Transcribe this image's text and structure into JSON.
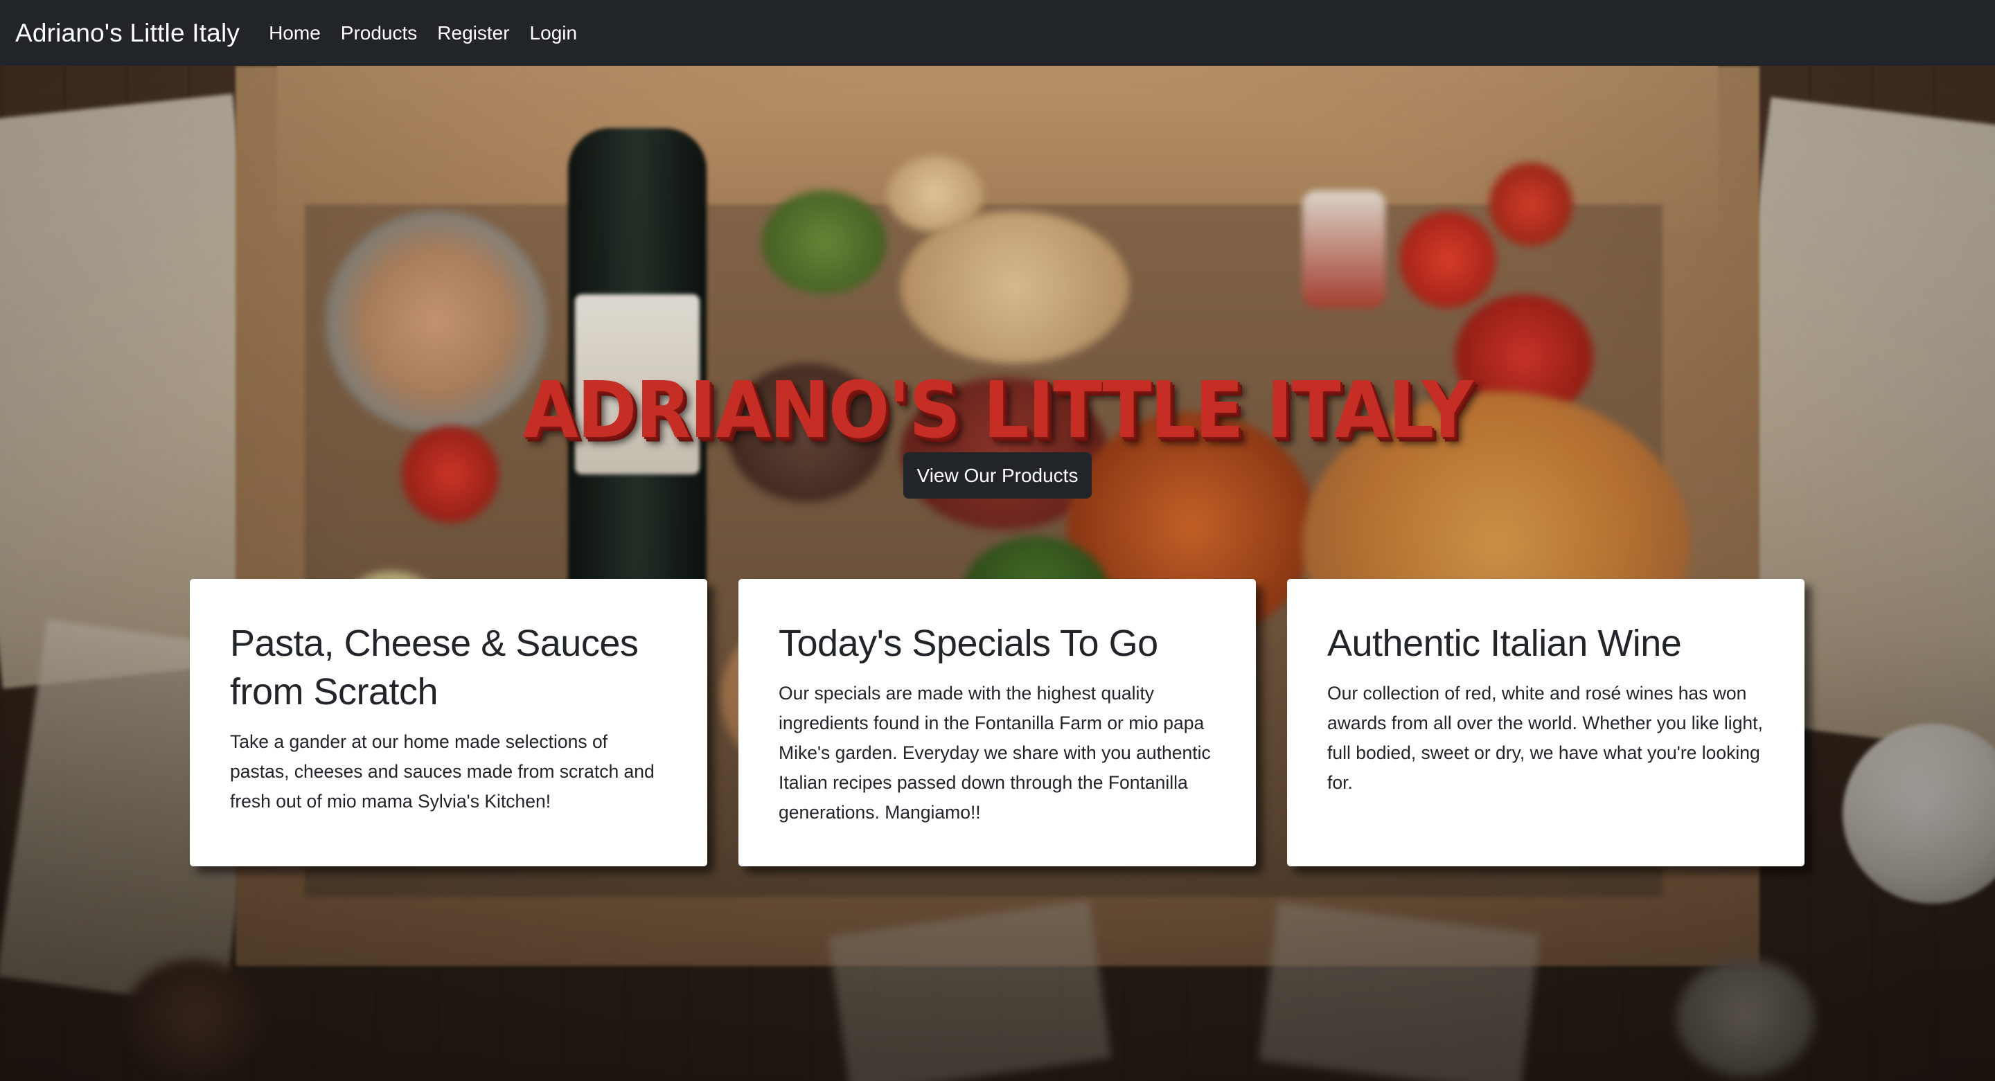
{
  "navbar": {
    "brand": "Adriano's Little Italy",
    "links": [
      {
        "label": "Home"
      },
      {
        "label": "Products"
      },
      {
        "label": "Register"
      },
      {
        "label": "Login"
      }
    ],
    "background": "#212529"
  },
  "hero": {
    "title": "Adriano's Little Italy",
    "title_color": "#c52d25",
    "cta_label": "View Our Products"
  },
  "cards": [
    {
      "title": "Pasta, Cheese & Sauces from Scratch",
      "text": "Take a gander at our home made selections of pastas, cheeses and sauces made from scratch and fresh out of mio mama Sylvia's Kitchen!"
    },
    {
      "title": "Today's Specials To Go",
      "text": "Our specials are made with the highest quality ingredients found in the Fontanilla Farm or mio papa Mike's garden. Everyday we share with you authentic Italian recipes passed down through the Fontanilla generations. Mangiamo!!"
    },
    {
      "title": "Authentic Italian Wine",
      "text": "Our collection of red, white and rosé wines has won awards from all over the world. Whether you like light, full bodied, sweet or dry, we have what you're looking for."
    }
  ]
}
